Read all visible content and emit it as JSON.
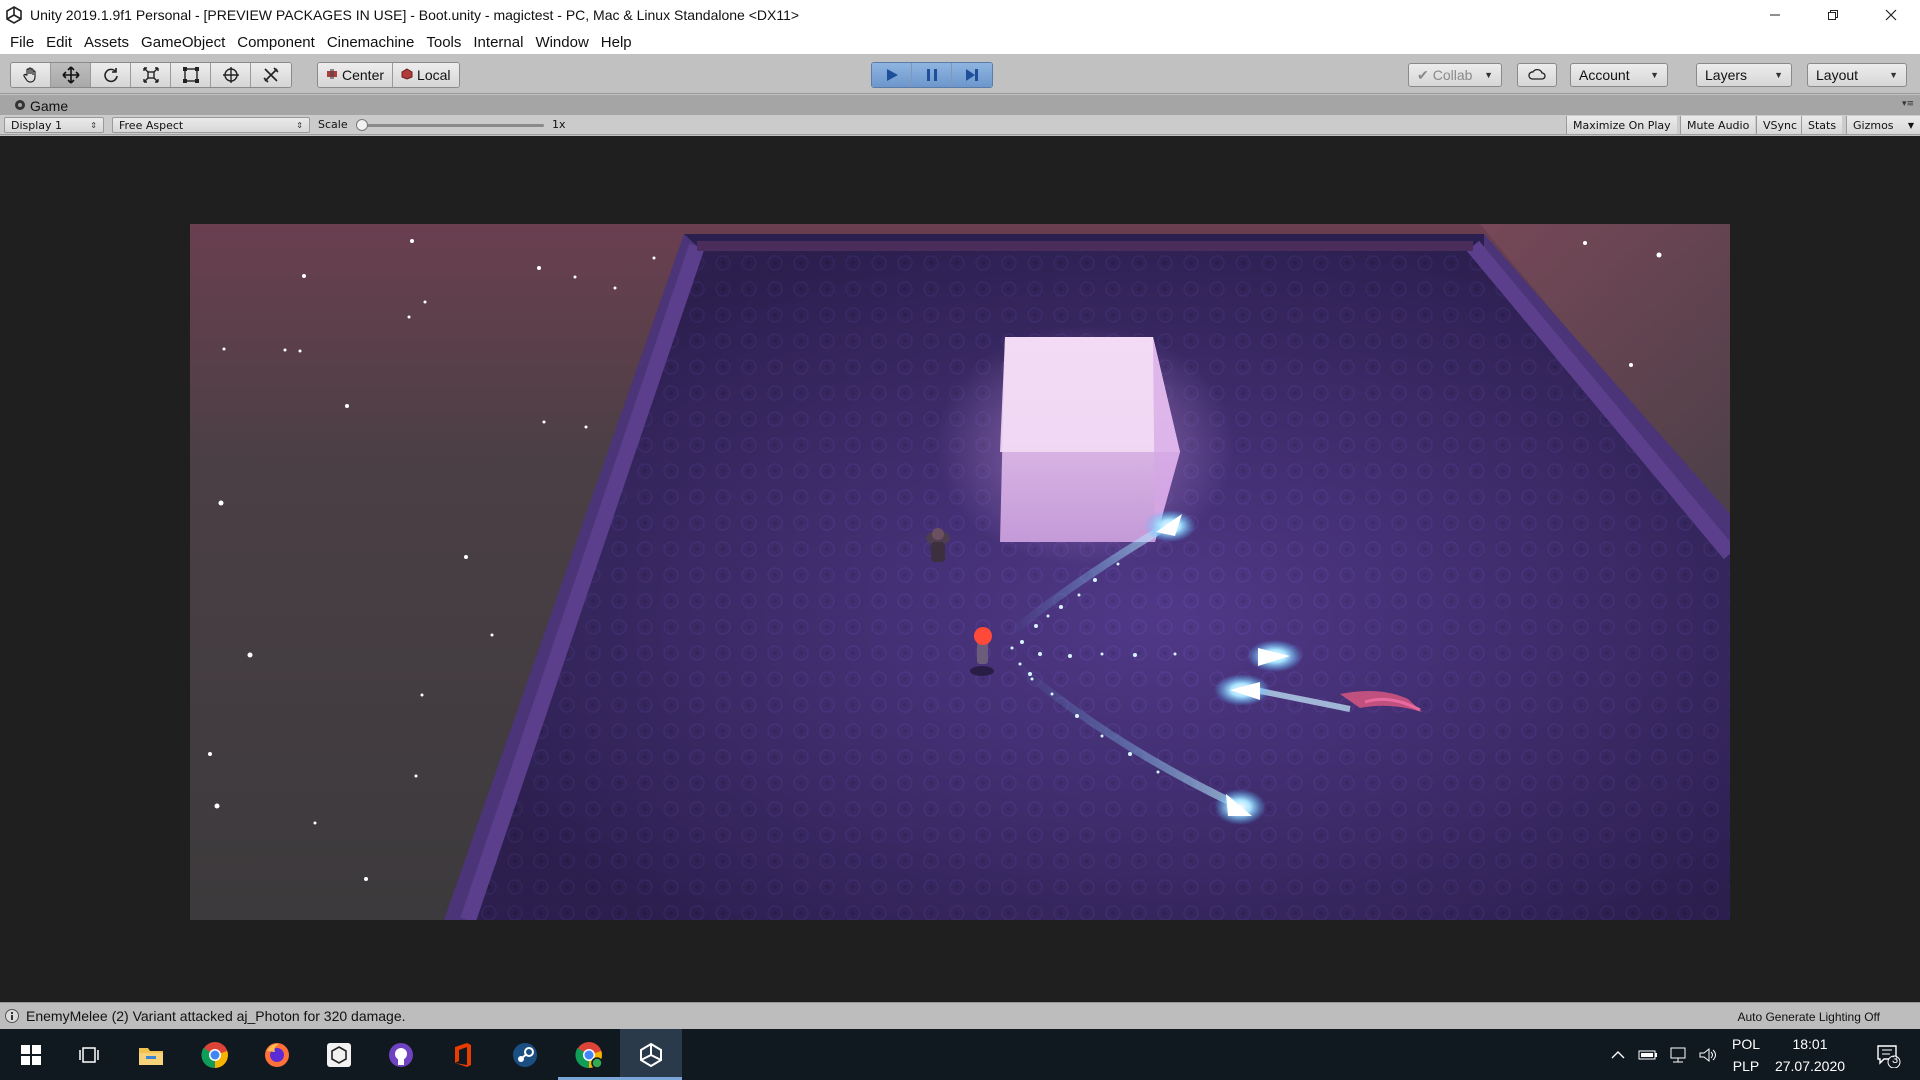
{
  "window": {
    "title": "Unity 2019.1.9f1 Personal - [PREVIEW PACKAGES IN USE] - Boot.unity - magictest - PC, Mac & Linux Standalone <DX11>",
    "controls": [
      "minimize-icon",
      "restore-icon",
      "close-icon"
    ]
  },
  "menu": {
    "items": [
      "File",
      "Edit",
      "Assets",
      "GameObject",
      "Component",
      "Cinemachine",
      "Tools",
      "Internal",
      "Window",
      "Help"
    ]
  },
  "toolbar": {
    "transform_tools": [
      "hand-icon",
      "move-icon",
      "rotate-icon",
      "scale-icon",
      "rect-transform-icon",
      "transform-icon",
      "custom-tool-icon"
    ],
    "active_tool": "move-icon",
    "pivot_label": "Center",
    "space_label": "Local",
    "play_controls": [
      "play-icon",
      "pause-icon",
      "step-icon"
    ],
    "collab_label": "Collab",
    "account_label": "Account",
    "layers_label": "Layers",
    "layout_label": "Layout",
    "accent": "#6d97cc"
  },
  "game_tab": {
    "label": "Game"
  },
  "game_bar": {
    "display": "Display 1",
    "aspect": "Free Aspect",
    "scale_label": "Scale",
    "scale_value": "1x",
    "toggles": [
      "Maximize On Play",
      "Mute Audio",
      "VSync",
      "Stats",
      "Gizmos"
    ]
  },
  "status": {
    "message": "EnemyMelee (2) Variant attacked aj_Photon for 320 damage.",
    "lighting": "Auto Generate Lighting Off"
  },
  "taskbar": {
    "apps": [
      "windows-start-icon",
      "task-view-icon",
      "file-explorer-icon",
      "chrome-icon",
      "firefox-icon",
      "unity-hub-icon",
      "github-desktop-icon",
      "office-icon",
      "steam-icon",
      "chrome-profile-icon",
      "unity-editor-icon"
    ],
    "language_line1": "POL",
    "language_line2": "PLP",
    "time": "18:01",
    "date": "27.07.2020",
    "notification_count": "3"
  }
}
